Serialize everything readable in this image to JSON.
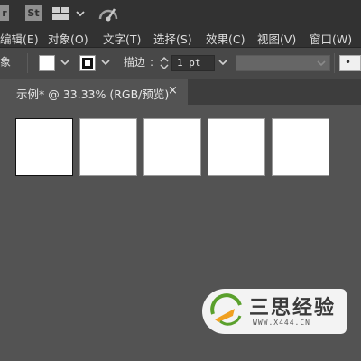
{
  "appbar": {
    "partial_app_letter": "r",
    "stock_label": "St",
    "layout_icon": "workspace-grid-icon",
    "sync_icon": "gpu-performance-icon"
  },
  "menubar": {
    "items": [
      {
        "label": "编辑(E)"
      },
      {
        "label": "对象(O)"
      },
      {
        "label": "文字(T)"
      },
      {
        "label": "选择(S)"
      },
      {
        "label": "效果(C)"
      },
      {
        "label": "视图(V)"
      },
      {
        "label": "窗口(W)"
      }
    ]
  },
  "controlbar": {
    "partial_label": "象",
    "fill_color": "#ffffff",
    "stroke_icon": "stroke-swatch-icon",
    "stroke_label": "描边",
    "stroke_colon": ":",
    "stroke_value": "1 pt",
    "dot_label": "•"
  },
  "document": {
    "tab_title": "示例* @ 33.33% (RGB/预览)",
    "close_glyph": "×"
  },
  "artboards": {
    "count": 5,
    "selected_index": 0
  },
  "watermark": {
    "name": "三思经验",
    "url": "WWW.X444.CN"
  },
  "colors": {
    "canvas": "#535353",
    "bar": "#323232",
    "controlbar": "#484848",
    "accent_green": "#5aa02c",
    "accent_orange": "#f0a020"
  }
}
